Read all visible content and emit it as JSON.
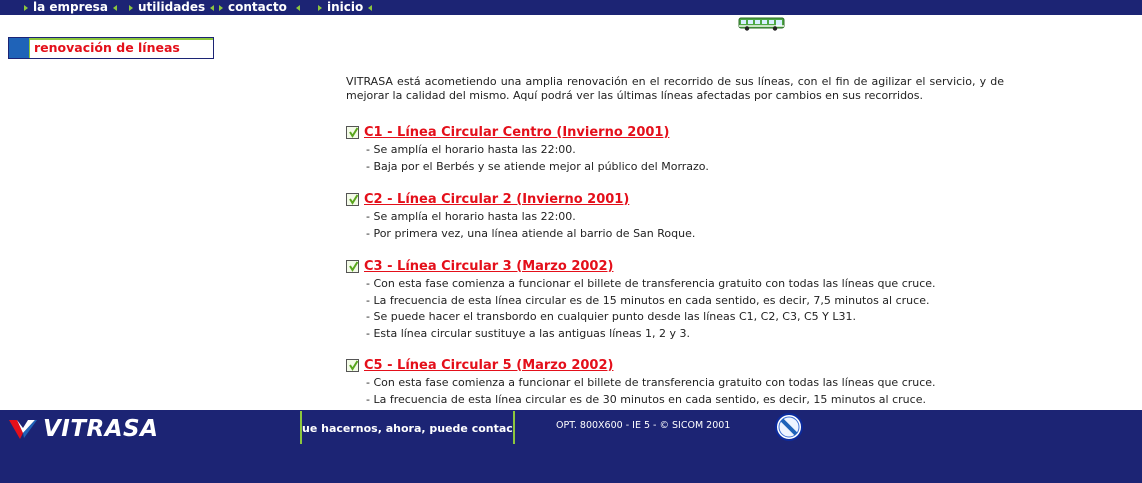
{
  "nav": {
    "items": [
      "la empresa",
      "utilidades",
      "contacto",
      "inicio"
    ]
  },
  "section": {
    "title": "renovación de líneas"
  },
  "intro": "VITRASA está acometiendo una amplia renovación en el recorrido de sus líneas, con el fin de agilizar el servicio, y de mejorar la calidad del mismo. Aquí podrá ver las últimas líneas afectadas por cambios en sus recorridos.",
  "lines": [
    {
      "title": "C1 - Línea Circular Centro (Invierno 2001)",
      "notes": [
        "- Se amplía el horario hasta las 22:00.",
        "- Baja por el Berbés y se atiende mejor al público del Morrazo."
      ]
    },
    {
      "title": "C2 - Línea Circular 2 (Invierno 2001)",
      "notes": [
        "- Se amplía el horario hasta las 22:00.",
        "- Por primera vez, una línea atiende al barrio de San Roque."
      ]
    },
    {
      "title": "C3 - Línea Circular 3 (Marzo 2002)",
      "notes": [
        "- Con esta fase comienza a funcionar el billete de transferencia gratuito con todas las líneas que cruce.",
        "- La frecuencia de esta línea circular es de 15 minutos en cada sentido, es decir, 7,5 minutos al cruce.",
        "- Se puede hacer el transbordo en cualquier punto desde las líneas C1, C2, C3, C5 Y L31.",
        "- Esta línea circular sustituye a las antiguas líneas 1, 2 y 3."
      ]
    },
    {
      "title": "C5 - Línea Circular 5 (Marzo 2002)",
      "notes": [
        "- Con esta fase comienza a funcionar el billete de transferencia gratuito con todas las líneas que cruce.",
        "- La frecuencia de esta línea circular es de 30 minutos en cada sentido, es decir, 15 minutos al cruce."
      ]
    }
  ],
  "footer": {
    "logo": "VITRASA",
    "ticker": "ue hacernos, ahora, puede contactar co",
    "info": "OPT. 800X600 - IE 5 - © SICOM 2001"
  },
  "icons": {
    "nav_arrows": "triangle-arrow-icon",
    "bus": "bus-icon",
    "check": "check-icon",
    "logo_mark": "vitrasa-v-logo-icon",
    "footer_sign": "no-entry-sign-icon"
  },
  "colors": {
    "navy": "#1c2474",
    "red": "#e40f1a",
    "green": "#8cc63e",
    "blue": "#1f63b8"
  }
}
